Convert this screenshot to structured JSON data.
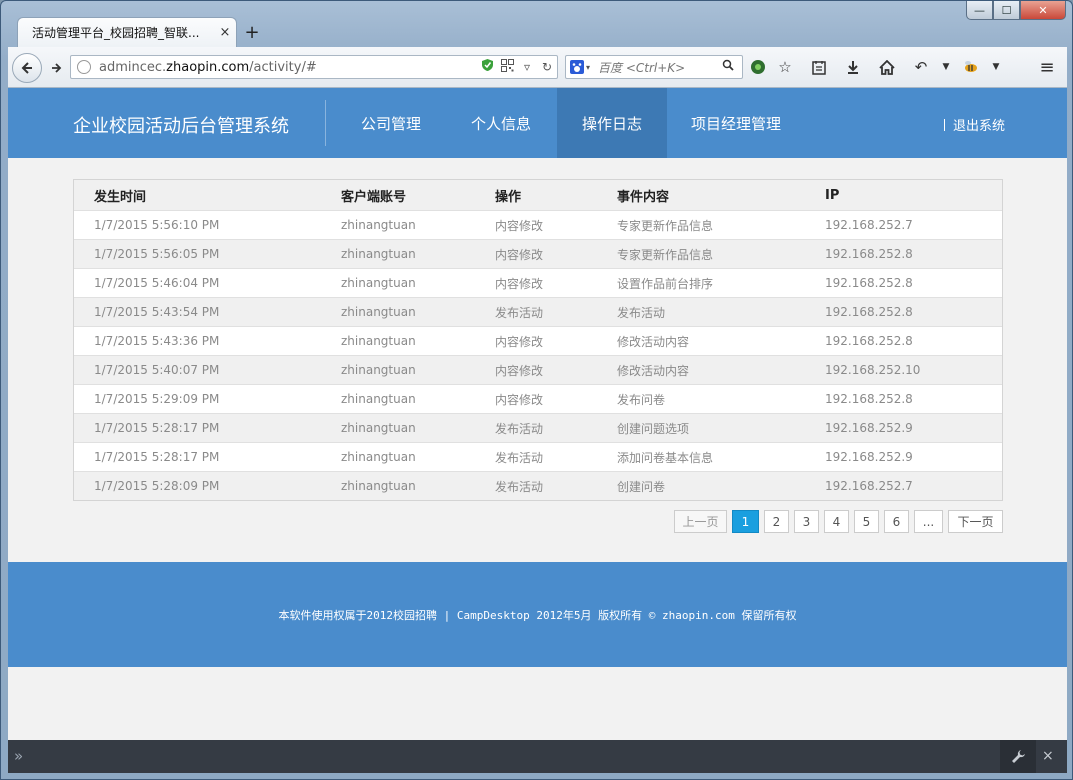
{
  "browser": {
    "tab_title": "活动管理平台_校园招聘_智联...",
    "tab_close": "×",
    "new_tab": "+",
    "url_prefix": "admincec.",
    "url_domain": "zhaopin.com",
    "url_path": "/activity/#",
    "search_placeholder": "百度 <Ctrl+K>",
    "controls": {
      "minimize": "—",
      "maximize": "☐",
      "close": "✕"
    }
  },
  "header": {
    "brand": "企业校园活动后台管理系统",
    "menu": [
      {
        "label": "公司管理"
      },
      {
        "label": "个人信息"
      },
      {
        "label": "操作日志"
      },
      {
        "label": "项目经理管理"
      }
    ],
    "logout": "退出系统"
  },
  "table": {
    "columns": [
      "发生时间",
      "客户端账号",
      "操作",
      "事件内容",
      "IP"
    ],
    "rows": [
      [
        "1/7/2015 5:56:10 PM",
        "zhinangtuan",
        "内容修改",
        "专家更新作品信息",
        "192.168.252.7"
      ],
      [
        "1/7/2015 5:56:05 PM",
        "zhinangtuan",
        "内容修改",
        "专家更新作品信息",
        "192.168.252.8"
      ],
      [
        "1/7/2015 5:46:04 PM",
        "zhinangtuan",
        "内容修改",
        "设置作品前台排序",
        "192.168.252.8"
      ],
      [
        "1/7/2015 5:43:54 PM",
        "zhinangtuan",
        "发布活动",
        "发布活动",
        "192.168.252.8"
      ],
      [
        "1/7/2015 5:43:36 PM",
        "zhinangtuan",
        "内容修改",
        "修改活动内容",
        "192.168.252.8"
      ],
      [
        "1/7/2015 5:40:07 PM",
        "zhinangtuan",
        "内容修改",
        "修改活动内容",
        "192.168.252.10"
      ],
      [
        "1/7/2015 5:29:09 PM",
        "zhinangtuan",
        "内容修改",
        "发布问卷",
        "192.168.252.8"
      ],
      [
        "1/7/2015 5:28:17 PM",
        "zhinangtuan",
        "发布活动",
        "创建问题选项",
        "192.168.252.9"
      ],
      [
        "1/7/2015 5:28:17 PM",
        "zhinangtuan",
        "发布活动",
        "添加问卷基本信息",
        "192.168.252.9"
      ],
      [
        "1/7/2015 5:28:09 PM",
        "zhinangtuan",
        "发布活动",
        "创建问卷",
        "192.168.252.7"
      ]
    ]
  },
  "pager": {
    "prev": "上一页",
    "pages": [
      "1",
      "2",
      "3",
      "4",
      "5",
      "6"
    ],
    "ellipsis": "...",
    "next": "下一页",
    "current": "1"
  },
  "footer": {
    "text": "本软件使用权属于2012校园招聘 | CampDesktop 2012年5月 版权所有 © zhaopin.com 保留所有权"
  },
  "devtools": {
    "prompt": "»",
    "close": "×"
  },
  "colors": {
    "header": "#4a8ccc",
    "active_menu": "#3d79b4",
    "current_page": "#1a9fdf"
  }
}
